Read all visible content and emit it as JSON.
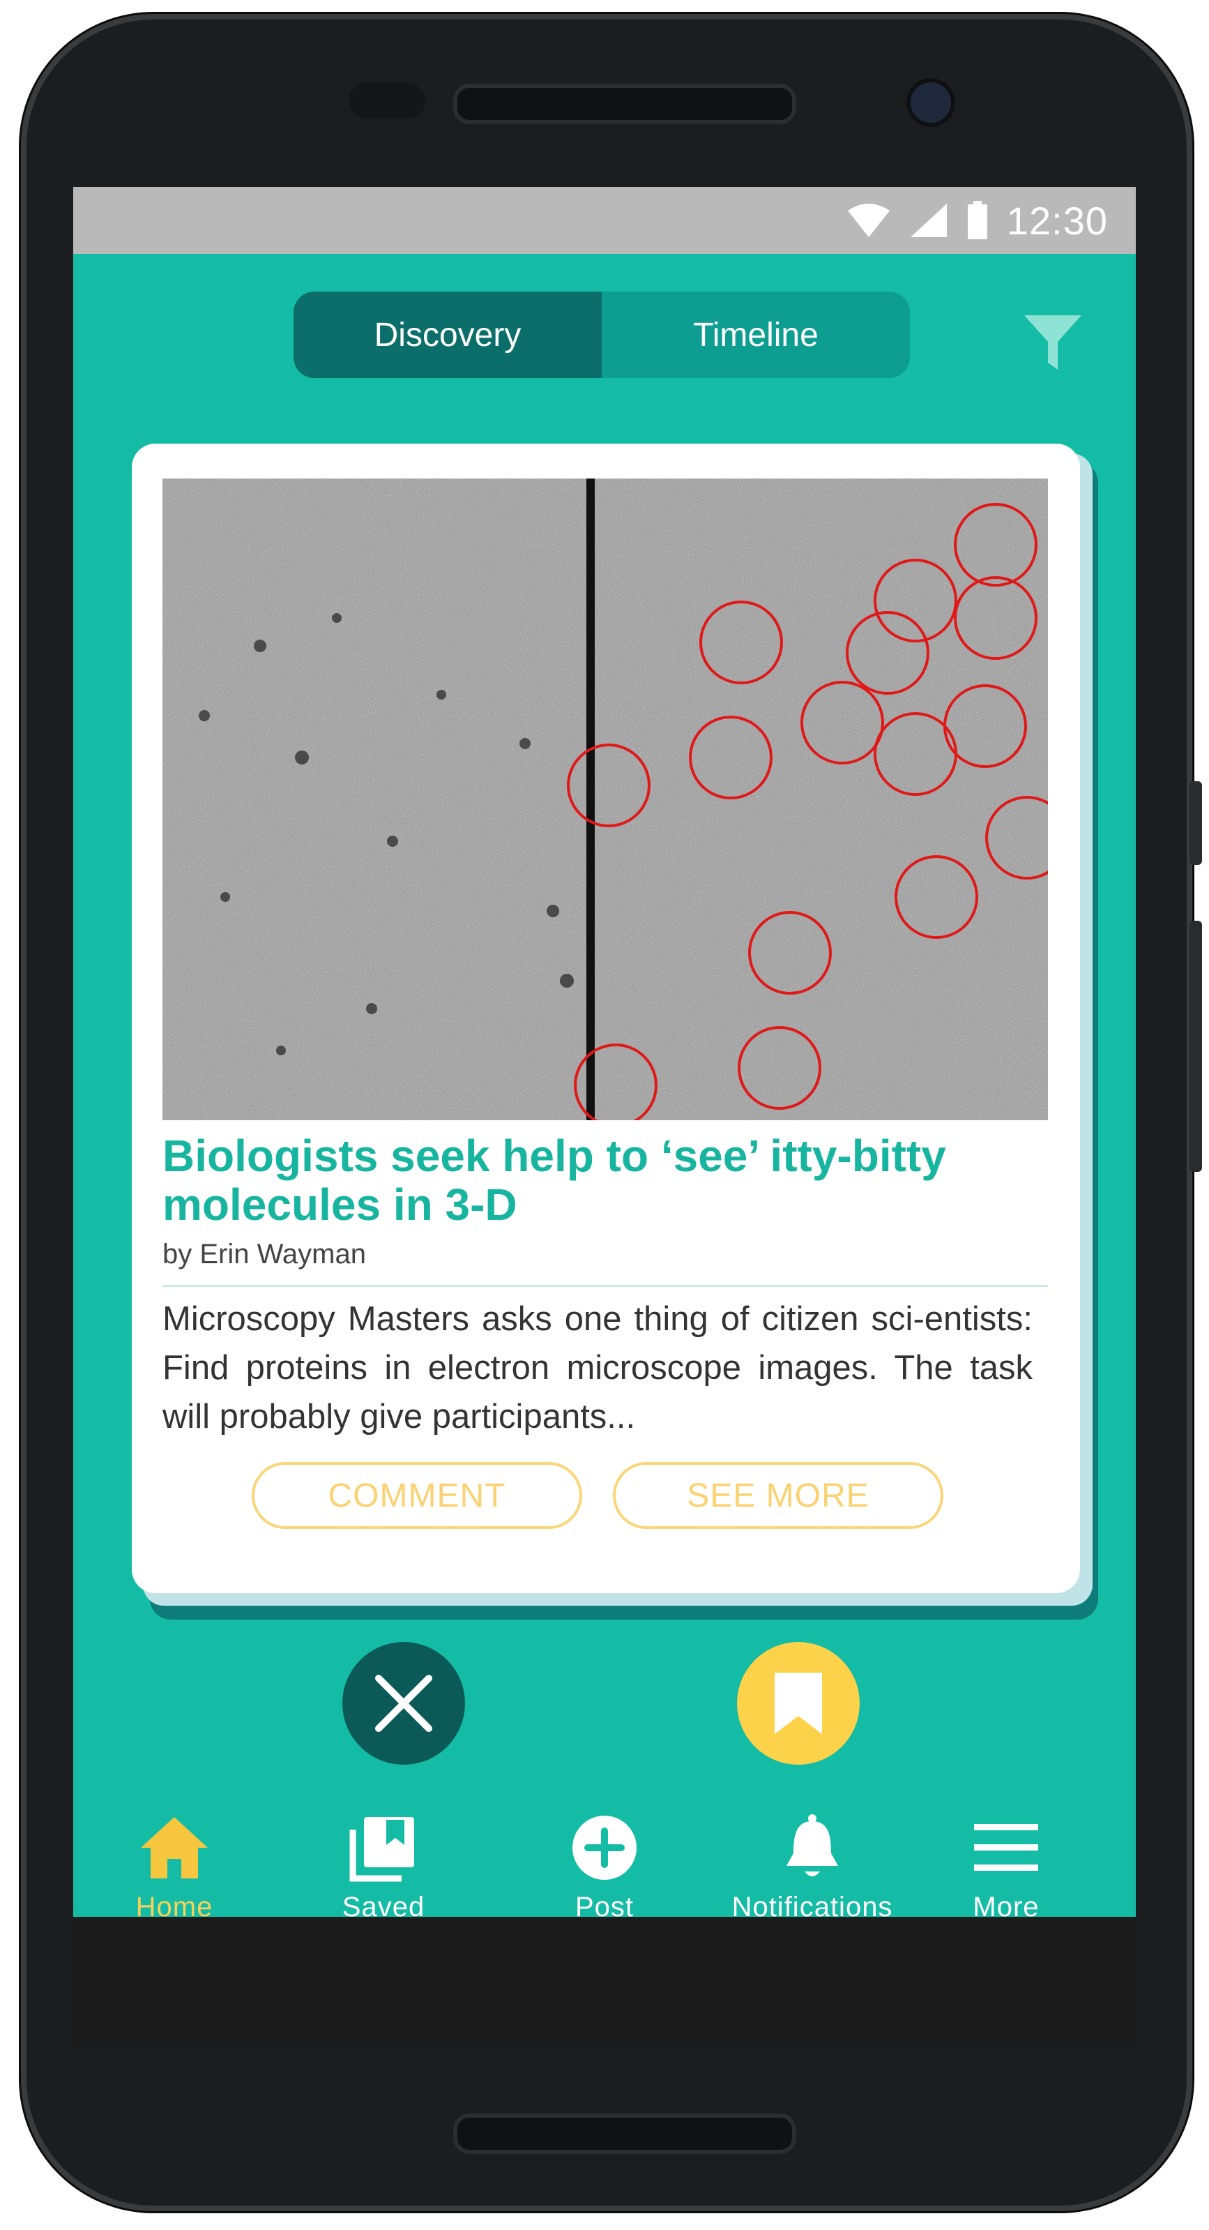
{
  "status_bar": {
    "time": "12:30"
  },
  "tabs": [
    {
      "label": "Discovery",
      "active": true
    },
    {
      "label": "Timeline",
      "active": false
    }
  ],
  "toolbar": {
    "filter_icon": "filter-icon"
  },
  "card": {
    "image_icon": "microscopy-image",
    "title": "Biologists seek help to ‘see’ itty-bitty molecules in 3-D",
    "byline": "by Erin Wayman",
    "summary": "Microscopy Masters asks one thing of citizen sci-entists: Find proteins in electron microscope images. The task will probably give participants...",
    "comment_label": "COMMENT",
    "see_more_label": "SEE MORE"
  },
  "actions": {
    "dismiss_icon": "close-icon",
    "save_icon": "bookmark-icon"
  },
  "nav": [
    {
      "label": "Home",
      "icon": "home-icon",
      "active": true
    },
    {
      "label": "Saved",
      "icon": "saved-icon",
      "active": false
    },
    {
      "label": "Post",
      "icon": "plus-circle-icon",
      "active": false
    },
    {
      "label": "Notifications",
      "icon": "bell-icon",
      "active": false
    },
    {
      "label": "More",
      "icon": "menu-icon",
      "active": false
    }
  ],
  "colors": {
    "brand": "#14bca5",
    "tab_active": "#0b6e6a",
    "tab_inactive": "#0e9d91",
    "accent": "#fcd24a",
    "title": "#17b59f"
  }
}
